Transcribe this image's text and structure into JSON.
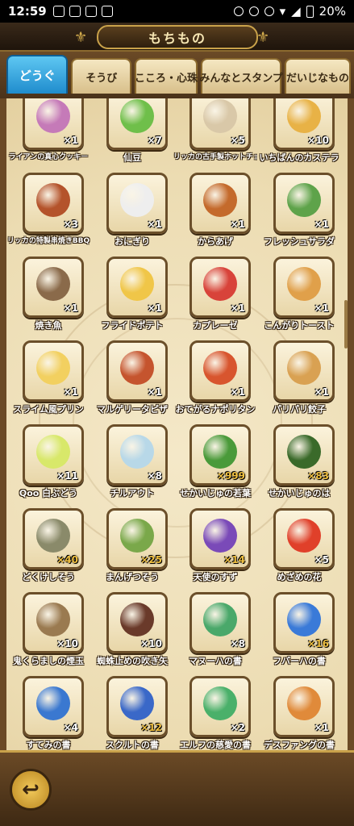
{
  "status": {
    "time": "12:59",
    "battery": "20%"
  },
  "header": {
    "title": "もちもの"
  },
  "tabs": [
    {
      "label": "どうぐ",
      "active": true
    },
    {
      "label": "そうび"
    },
    {
      "label": "こころ・心珠"
    },
    {
      "label": "みんなとスタンプ"
    },
    {
      "label": "だいじなもの"
    }
  ],
  "items": [
    {
      "name": "ライアンの真心クッキー",
      "count": "×1",
      "color": "#c57ab8"
    },
    {
      "name": "仙豆",
      "count": "×7",
      "color": "#6fbf4a"
    },
    {
      "name": "リッカの古手製ホットチョコレート",
      "count": "×5",
      "color": "#d9c8a8"
    },
    {
      "name": "いちばんのカステラ",
      "count": "×10",
      "color": "#e8b246"
    },
    {
      "name": "リッカの特製串焼きBBQ",
      "count": "×3",
      "color": "#b4532b"
    },
    {
      "name": "おにぎり",
      "count": "×1",
      "color": "#eeeeee"
    },
    {
      "name": "からあげ",
      "count": "×1",
      "color": "#c46a2c"
    },
    {
      "name": "フレッシュサラダ",
      "count": "×1",
      "color": "#5ea34a"
    },
    {
      "name": "焼き魚",
      "count": "×1",
      "color": "#8a6a4a"
    },
    {
      "name": "フライドポテト",
      "count": "×1",
      "color": "#f0c648"
    },
    {
      "name": "カプレーゼ",
      "count": "×1",
      "color": "#d8433a"
    },
    {
      "name": "こんがりトースト",
      "count": "×1",
      "color": "#e0a04a"
    },
    {
      "name": "スライム風プリン",
      "count": "×1",
      "color": "#f2d060"
    },
    {
      "name": "マルゲリータピザ",
      "count": "×1",
      "color": "#c5542e"
    },
    {
      "name": "おてがるナポリタン",
      "count": "×1",
      "color": "#d8552e"
    },
    {
      "name": "パリパリ餃子",
      "count": "×1",
      "color": "#d9a152"
    },
    {
      "name": "Qoo 白ぶどう",
      "count": "×11",
      "color": "#d8e86a"
    },
    {
      "name": "チルアウト",
      "count": "×8",
      "color": "#b8d8e8"
    },
    {
      "name": "せかいじゅの若葉",
      "count": "×999",
      "color": "#4a9a3a",
      "gold": true
    },
    {
      "name": "せかいじゅのは",
      "count": "×83",
      "color": "#3a6a2a",
      "gold": true
    },
    {
      "name": "どくけしそう",
      "count": "×40",
      "color": "#8a8a6a",
      "gold": true
    },
    {
      "name": "まんげつそう",
      "count": "×25",
      "color": "#7aa84a",
      "gold": true
    },
    {
      "name": "天使のすず",
      "count": "×14",
      "color": "#7a4ab8",
      "gold": true
    },
    {
      "name": "めざめの花",
      "count": "×5",
      "color": "#e0402a"
    },
    {
      "name": "鬼くらましの煙玉",
      "count": "×10",
      "color": "#9a7a50"
    },
    {
      "name": "蜘蛛止めの吹き矢",
      "count": "×10",
      "color": "#6a3a2a"
    },
    {
      "name": "マヌーハの書",
      "count": "×8",
      "color": "#4aa86a"
    },
    {
      "name": "フバーハの書",
      "count": "×16",
      "color": "#3a7ad8",
      "gold": true
    },
    {
      "name": "すてみの書",
      "count": "×4",
      "color": "#3a78d0"
    },
    {
      "name": "スクルトの書",
      "count": "×12",
      "color": "#3a68c8",
      "gold": true
    },
    {
      "name": "エルフの慈愛の書",
      "count": "×2",
      "color": "#4ab06a"
    },
    {
      "name": "デスファングの書",
      "count": "×1",
      "color": "#e08a3a"
    }
  ],
  "footer": {
    "back_label": "↩"
  }
}
